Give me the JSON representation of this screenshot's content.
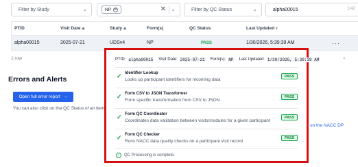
{
  "filters": {
    "study_placeholder": "Filter by Study",
    "selected_chip": "NP",
    "qc_placeholder": "Filter by QC Status",
    "search_value": "alpha00015",
    "search_count": "1/42"
  },
  "table": {
    "columns": [
      "PTID",
      "Visit Date",
      "Study",
      "Form(s)",
      "QC Status",
      "Last Updated"
    ],
    "row": {
      "ptid": "alpha00015",
      "visit_date": "2025-07-21",
      "study": "UDSv4",
      "forms": "NP",
      "qc_status": "PASS",
      "last_updated": "1/30/2026, 5:39:39 AM",
      "more": "···"
    },
    "rows_count": "1 row",
    "pager": "«"
  },
  "errors": {
    "title": "Errors and Alerts",
    "button": "Open full error report",
    "hint": "You can also click on the QC Status of an item",
    "dp_link": "on the NACC DP"
  },
  "popover": {
    "ptid_label": "PTID:",
    "ptid": "alpha00015",
    "visit_label": "Visit Date:",
    "visit_date": "2025-07-21",
    "forms_label": "Form(s):",
    "forms": "NP",
    "updated_label": "Last Updated:",
    "updated": "1/30/2026, 5:39:39 AM",
    "checks": [
      {
        "name": "Identifier Lookup",
        "desc": "Looks up participant identifiers for incoming data",
        "status": "PASS"
      },
      {
        "name": "Form CSV to JSON Transformer",
        "desc": "Form specific transformation from CSV to JSON",
        "status": "PASS"
      },
      {
        "name": "Form QC Coordinator",
        "desc": "Coordinates data validation between visits/modules for a given participant",
        "status": "PASS"
      },
      {
        "name": "Form QC Checker",
        "desc": "Runs NACC data quality checks on a participant visit record",
        "status": "PASS"
      }
    ],
    "complete_text": "QC Processing is complete."
  },
  "colors": {
    "accent": "#2563eb",
    "pass": "#16a34a",
    "highlight_border": "#d80f0f"
  }
}
